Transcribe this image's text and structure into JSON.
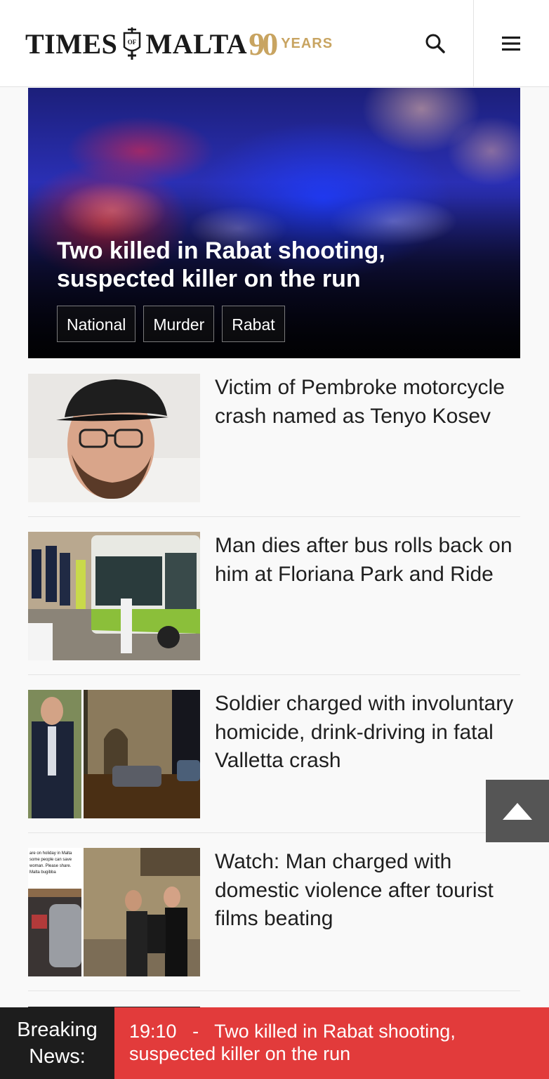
{
  "header": {
    "logo_left": "TIMES",
    "logo_right": "MALTA",
    "logo_ninety": "90",
    "logo_years": "YEARS",
    "brand_gold": "#c8a461"
  },
  "hero": {
    "title": "Two killed in Rabat shooting, suspected killer on the run",
    "tags": [
      "National",
      "Murder",
      "Rabat"
    ]
  },
  "articles": [
    {
      "headline": "Victim of Pembroke motorcycle crash named as Tenyo Kosev"
    },
    {
      "headline": "Man dies after bus rolls back on him at Floriana Park and Ride"
    },
    {
      "headline": "Soldier charged with involuntary homicide, drink-driving in fatal Valletta crash"
    },
    {
      "headline": "Watch: Man charged with domestic violence after tourist films beating"
    }
  ],
  "thumb4_caption": "are on holiday in Malta some people can save woman. Please share. Malta bugibba",
  "breaking": {
    "label": "Breaking News:",
    "time": "19:10",
    "separator": "-",
    "text": "Two killed in Rabat shooting, suspected killer on the run",
    "color": "#e23b3b"
  },
  "icons": {
    "search": "search-icon",
    "menu": "hamburger-menu-icon",
    "back_to_top": "arrow-up-icon"
  }
}
